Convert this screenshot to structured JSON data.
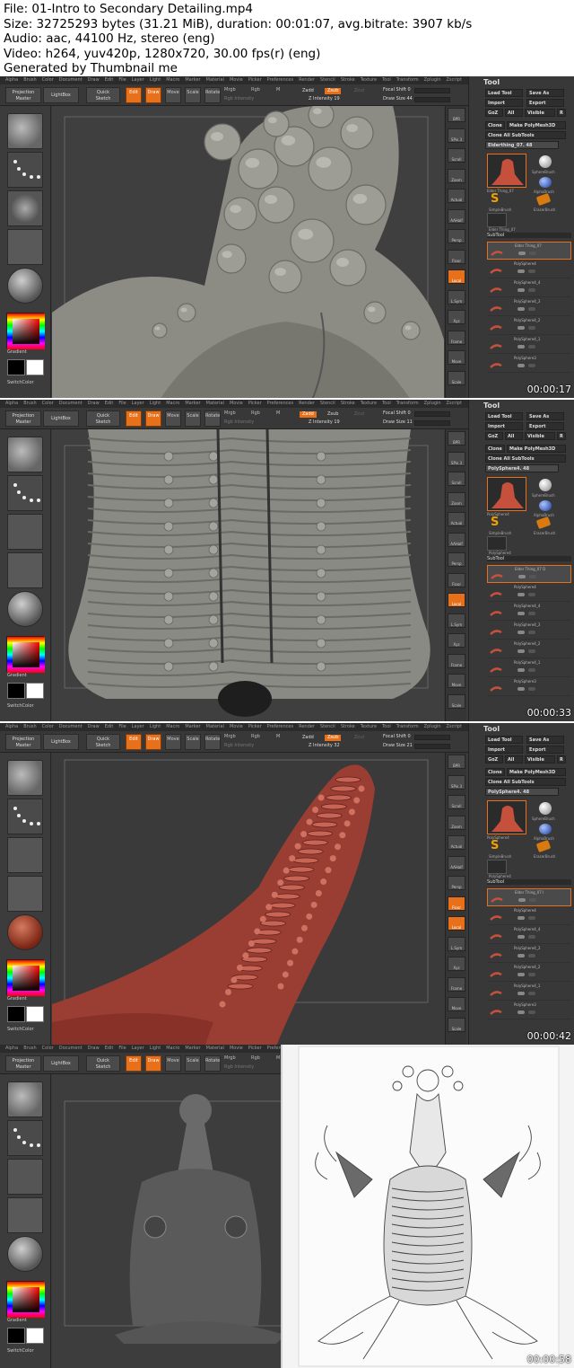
{
  "header": {
    "file": "File: 01-Intro to Secondary Detailing.mp4",
    "size": "Size: 32725293 bytes (31.21 MiB), duration: 00:01:07, avg.bitrate: 3907 kb/s",
    "audio": "Audio: aac, 44100 Hz, stereo (eng)",
    "video": "Video: h264, yuv420p, 1280x720, 30.00 fps(r) (eng)",
    "generated": "Generated by Thumbnail me"
  },
  "menu": [
    "Alpha",
    "Brush",
    "Color",
    "Document",
    "Draw",
    "Edit",
    "File",
    "Layer",
    "Light",
    "Macro",
    "Marker",
    "Material",
    "Movie",
    "Picker",
    "Preferences",
    "Render",
    "Stencil",
    "Stroke",
    "Texture",
    "Tool",
    "Transform",
    "Zplugin",
    "Zscript"
  ],
  "toolbar": {
    "projection_master": "Projection Master",
    "lightbox": "LightBox",
    "quick_sketch": "Quick Sketch",
    "edit": "Edit",
    "draw": "Draw",
    "move": "Move",
    "scale": "Scale",
    "rotate": "Rotate",
    "mrgb": "Mrgb",
    "rgb": "Rgb",
    "m": "M",
    "rgb_intensity": "Rgb Intensity",
    "zadd": "Zadd",
    "zsub": "Zsub",
    "zcut": "Zcut",
    "focal_label": "Focal Shift"
  },
  "left_tray": {
    "gradient": "Gradient",
    "switch_color": "SwitchColor"
  },
  "right_shelf": [
    "BPR",
    "SPix 3",
    "Scroll",
    "Zoom",
    "Actual",
    "AAHalf",
    "Persp",
    "Floor",
    "Local",
    "L.Sym",
    "Xyz",
    "Frame",
    "Move",
    "Scale"
  ],
  "tool_panel": {
    "title": "Tool",
    "load_tool": "Load Tool",
    "save_as": "Save As",
    "import": "Import",
    "export": "Export",
    "goz": "GoZ",
    "all": "All",
    "visible": "Visible",
    "r": "R",
    "clone": "Clone",
    "make_polymesh": "Make PolyMesh3D",
    "clone_all": "Clone All SubTools",
    "sphere_brush": "SphereBrush",
    "alpha_brush": "AlphaBrush",
    "simple_brush": "SimpleBrush",
    "eraser_brush": "EraserBrush",
    "subtool": "SubTool"
  },
  "frames": [
    {
      "time": "00:00:17",
      "current_tool": "Elderthing_07. 48",
      "z_intensity": "Z Intensity 19",
      "focal_shift": "Focal Shift 0",
      "draw_size": "Draw Size 44",
      "zadd_on": false,
      "zsub_on": true,
      "subtools": [
        "Elder Thing_07",
        "PolySphere4",
        "PolySphere4_4",
        "PolySphere4_3",
        "PolySphere4_2",
        "PolySphere4_1",
        "PolySphere3"
      ],
      "thumb_label": "Elder Thing_07",
      "extra_tool": "Elder Thing_07",
      "model_color": "#8c8c85"
    },
    {
      "time": "00:00:33",
      "current_tool": "PolySphere4. 48",
      "z_intensity": "Z Intensity 19",
      "focal_shift": "Focal Shift 0",
      "draw_size": "Draw Size 11",
      "zadd_on": true,
      "zsub_on": false,
      "subtools": [
        "Elder Thing_07 D",
        "PolySphere4",
        "PolySphere4_4",
        "PolySphere4_3",
        "PolySphere4_2",
        "PolySphere4_1",
        "PolySphere3"
      ],
      "thumb_label": "PolySphere4",
      "extra_tool": "PolySphere4",
      "model_color": "#8a8a84"
    },
    {
      "time": "00:00:42",
      "current_tool": "PolySphere4. 48",
      "z_intensity": "Z Intensity 32",
      "focal_shift": "Focal Shift 0",
      "draw_size": "Draw Size 21",
      "zadd_on": false,
      "zsub_on": true,
      "subtools": [
        "Elder Thing_07 I",
        "PolySphere4",
        "PolySphere4_4",
        "PolySphere4_3",
        "PolySphere4_2",
        "PolySphere4_1",
        "PolySphere3"
      ],
      "thumb_label": "PolySphere4",
      "extra_tool": "PolySphere4",
      "model_color": "#9a3d33"
    },
    {
      "time": "00:00:58",
      "model_color": "#6a6a6a"
    }
  ]
}
